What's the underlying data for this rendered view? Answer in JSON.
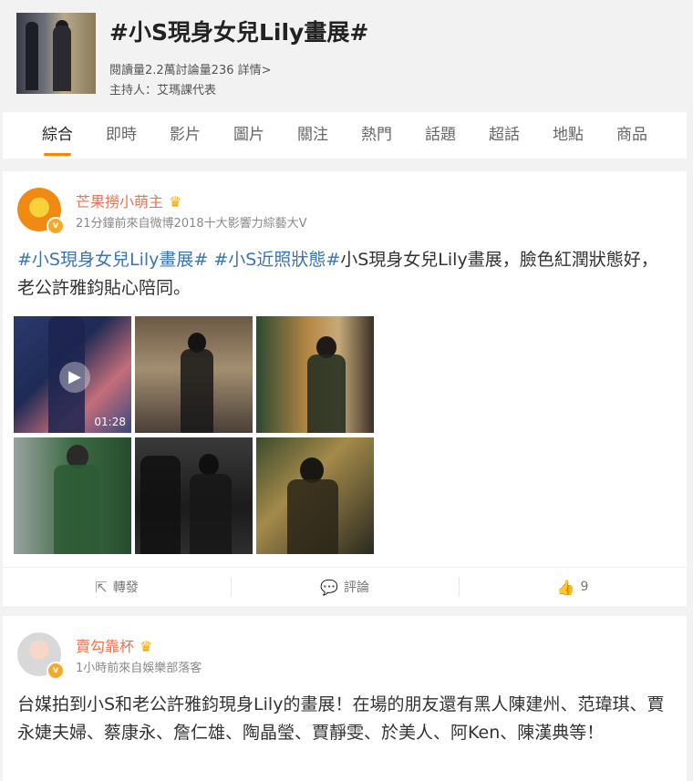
{
  "topic": {
    "title": "#小S現身女兒Lily畫展#",
    "stats": "閱讀量2.2萬討論量236 詳情>",
    "host": "主持人：艾瑪課代表"
  },
  "tabs": [
    "綜合",
    "即時",
    "影片",
    "圖片",
    "關注",
    "熱門",
    "話題",
    "超話",
    "地點",
    "商品"
  ],
  "posts": [
    {
      "username": "芒果撈小萌主",
      "meta": "21分鐘前來自微博2018十大影響力綜藝大V",
      "tags": [
        "#小S現身女兒Lily畫展#",
        "#小S近照狀態#"
      ],
      "body": "小S現身女兒Lily畫展，臉色紅潤狀態好，老公許雅鈞貼心陪同。",
      "video_duration": "01:28",
      "actions": {
        "repost": "轉發",
        "comment": "評論",
        "likes": "9"
      }
    },
    {
      "username": "賣勾靠杯",
      "meta": "1小時前來自娛樂部落客",
      "body": "台媒拍到小S和老公許雅鈞現身Lily的畫展！在場的朋友還有黑人陳建州、范瑋琪、賈永婕夫婦、蔡康永、詹仁雄、陶晶瑩、賈靜雯、於美人、阿Ken、陳漢典等！"
    }
  ],
  "colors": {
    "accent": "#ff8200",
    "username": "#eb7350",
    "hashtag": "#3b73b6",
    "badge": "#f9a825"
  },
  "icons": {
    "repost": "repost-icon",
    "comment": "comment-icon",
    "like": "thumbs-up-icon",
    "crown": "crown-icon",
    "verified": "verified-badge-icon",
    "play": "play-icon"
  }
}
